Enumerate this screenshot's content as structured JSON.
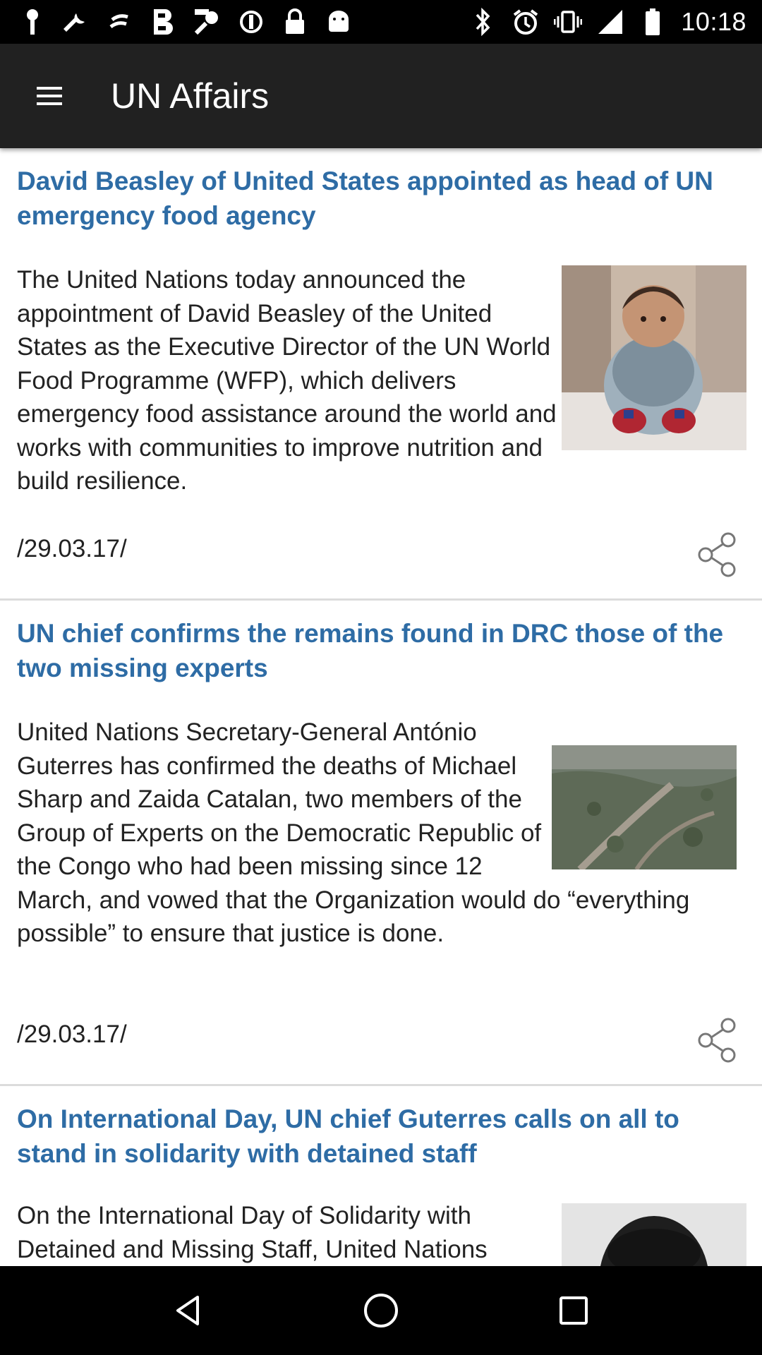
{
  "status_bar": {
    "time": "10:18",
    "left_icons": [
      "menu-dots-icon",
      "wrench-icon",
      "music-note-icon",
      "bold-b-icon",
      "fake-gps-icon",
      "blocked-icon",
      "lock-icon",
      "android-icon"
    ],
    "right_icons": [
      "bluetooth-icon",
      "alarm-icon",
      "vibrate-icon",
      "signal-icon",
      "battery-icon"
    ]
  },
  "app_bar": {
    "title": "UN Affairs",
    "menu_icon": "hamburger-menu-icon"
  },
  "colors": {
    "headline": "#2e6ca5",
    "app_bar": "#212121",
    "divider": "#dcdcdc"
  },
  "articles": [
    {
      "headline": "David Beasley of United States appointed as head of UN emergency food agency",
      "summary": "The United Nations today announced the appointment of David Beasley of the United States as the Executive Director of the UN World Food Programme (WFP), which delivers emergency food assistance around the world and works with communities to improve nutrition and build resilience.",
      "date": "/29.03.17/",
      "share_icon": "share-icon"
    },
    {
      "headline": "UN chief confirms the remains found in DRC those of the two missing experts",
      "summary": "United Nations Secretary-General António Guterres has confirmed the deaths of Michael Sharp and Zaida Catalan, two members of the Group of Experts on the Democratic Republic of the Congo who had been missing since 12 March, and vowed that the Organization would do “everything possible” to ensure that justice is done.",
      "date": "/29.03.17/",
      "share_icon": "share-icon"
    },
    {
      "headline": "On International Day, UN chief Guterres calls on all to stand in solidarity with detained staff",
      "summary": "On the International Day of Solidarity with Detained and Missing Staff, United Nations"
    }
  ],
  "nav_bar": {
    "icons": [
      "back-triangle-icon",
      "home-circle-icon",
      "recents-square-icon"
    ]
  }
}
